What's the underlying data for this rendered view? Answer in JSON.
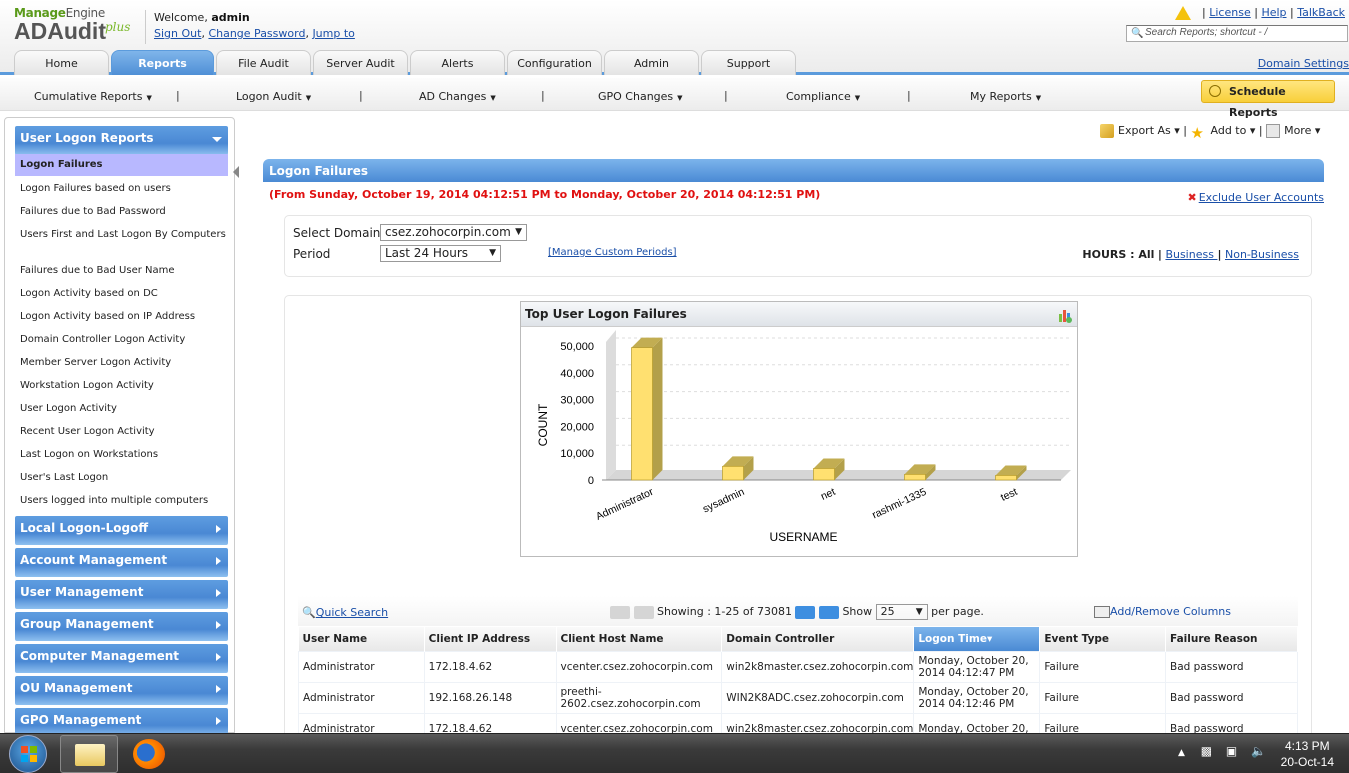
{
  "app": {
    "brand_vendor": "ManageEngine",
    "brand_vendor_bold": "Manage",
    "brand_vendor_light": "Engine",
    "product": "ADAudit",
    "product_suffix": "plus"
  },
  "header": {
    "welcome_prefix": "Welcome, ",
    "username": "admin",
    "links": [
      "Sign Out",
      "Change Password",
      "Jump to"
    ],
    "top_links": [
      "License",
      "Help",
      "TalkBack"
    ],
    "search_placeholder": "Search Reports; shortcut - /",
    "domain_settings": "Domain Settings",
    "tabs": [
      {
        "label": "Home"
      },
      {
        "label": "Reports",
        "active": true
      },
      {
        "label": "File Audit"
      },
      {
        "label": "Server Audit"
      },
      {
        "label": "Alerts"
      },
      {
        "label": "Configuration"
      },
      {
        "label": "Admin"
      },
      {
        "label": "Support"
      }
    ]
  },
  "menubar": {
    "items": [
      "Cumulative Reports",
      "Logon Audit",
      "AD Changes",
      "GPO Changes",
      "Compliance",
      "My Reports"
    ],
    "schedule_button": "Schedule Reports"
  },
  "sidebar": {
    "expanded_category": "User Logon Reports",
    "items": [
      "Logon Failures",
      "Logon Failures based on users",
      "Failures due to Bad Password",
      "Users First and Last Logon By Computers",
      "Failures due to Bad User Name",
      "Logon Activity based on DC",
      "Logon Activity based on IP Address",
      "Domain Controller Logon Activity",
      "Member Server Logon Activity",
      "Workstation Logon Activity",
      "User Logon Activity",
      "Recent User Logon Activity",
      "Last Logon on Workstations",
      "User's Last Logon",
      "Users logged into multiple computers"
    ],
    "active_item": "Logon Failures",
    "categories": [
      "Local Logon-Logoff",
      "Account Management",
      "User Management",
      "Group Management",
      "Computer Management",
      "OU Management",
      "GPO Management"
    ]
  },
  "actions": {
    "export": "Export As",
    "add": "Add to",
    "more": "More"
  },
  "report": {
    "title": "Logon Failures",
    "range": "(From Sunday, October 19, 2014 04:12:51 PM to Monday, October 20, 2014 04:12:51 PM)",
    "exclude_link": "Exclude User Accounts",
    "domain_label": "Select Domain",
    "domain_value": "csez.zohocorpin.com",
    "period_label": "Period",
    "period_value": "Last 24 Hours",
    "custom_periods": "[Manage Custom Periods]",
    "hours_label": "HOURS : ",
    "hours_all": "All",
    "hours_business": "Business ",
    "hours_nonbusiness": "Non-Business "
  },
  "chart_data": {
    "type": "bar",
    "title": "Top User Logon Failures",
    "categories": [
      "Administrator",
      "sysadmin",
      "net",
      "rashmi-1335",
      "test"
    ],
    "values": [
      49400,
      5100,
      4300,
      2100,
      1700
    ],
    "xlabel": "USERNAME",
    "ylabel": "COUNT",
    "ylim": [
      0,
      50000
    ],
    "yticks": [
      0,
      10000,
      20000,
      30000,
      40000,
      50000
    ],
    "ytick_labels": [
      "0",
      "10,000",
      "20,000",
      "30,000",
      "40,000",
      "50,000"
    ],
    "grid": true,
    "style": "3d",
    "bar_color": "#ffe070",
    "bar_side_color": "#b3a04a"
  },
  "grid": {
    "quick_search": "Quick Search",
    "showing_label": "Showing : ",
    "showing_value": "1-25 of 73081",
    "show_label": "Show",
    "per_page": "25",
    "per_page_suffix": "per page.",
    "add_remove": "Add/Remove Columns",
    "columns": [
      "User Name",
      "Client IP Address",
      "Client Host Name",
      "Domain Controller",
      "Logon Time",
      "Event Type",
      "Failure Reason"
    ],
    "sorted_column": "Logon Time",
    "rows": [
      [
        "Administrator",
        "172.18.4.62",
        "vcenter.csez.zohocorpin.com",
        "win2k8master.csez.zohocorpin.com",
        "Monday, October 20, 2014 04:12:47 PM",
        "Failure",
        "Bad password"
      ],
      [
        "Administrator",
        "192.168.26.148",
        "preethi-2602.csez.zohocorpin.com",
        "WIN2K8ADC.csez.zohocorpin.com",
        "Monday, October 20, 2014 04:12:46 PM",
        "Failure",
        "Bad password"
      ],
      [
        "Administrator",
        "172.18.4.62",
        "vcenter.csez.zohocorpin.com",
        "win2k8master.csez.zohocorpin.com",
        "Monday, October 20,",
        "Failure",
        "Bad password"
      ]
    ]
  },
  "taskbar": {
    "time": "4:13 PM",
    "date": "20-Oct-14"
  }
}
